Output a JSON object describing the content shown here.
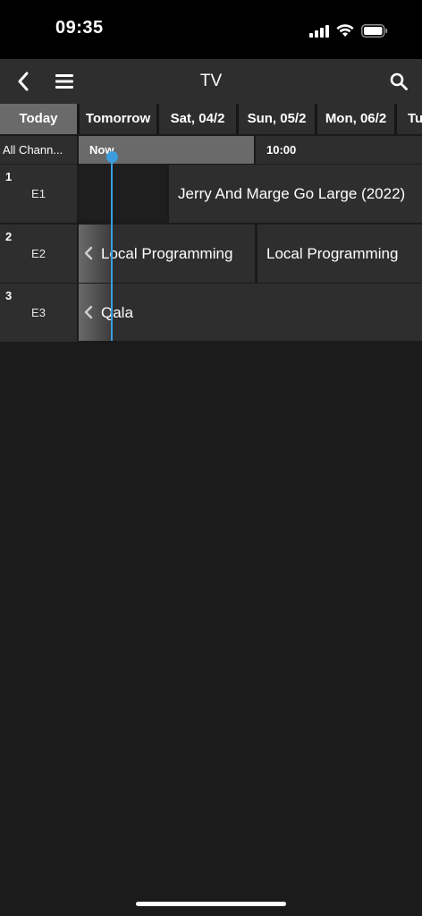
{
  "status_bar": {
    "time": "09:35",
    "icons": [
      "signal-icon",
      "wifi-icon",
      "battery-icon"
    ]
  },
  "nav": {
    "title": "TV",
    "back_icon": "chevron-left-icon",
    "menu_icon": "hamburger-menu-icon",
    "search_icon": "search-icon"
  },
  "day_tabs": [
    {
      "label": "Today",
      "active": true
    },
    {
      "label": "Tomorrow",
      "active": false
    },
    {
      "label": "Sat, 04/2",
      "active": false
    },
    {
      "label": "Sun, 05/2",
      "active": false
    },
    {
      "label": "Mon, 06/2",
      "active": false
    },
    {
      "label": "Tue",
      "active": false
    }
  ],
  "timeline": {
    "channel_filter": "All Chann...",
    "now_label": "Now",
    "slot_label": "10:00"
  },
  "channels": [
    {
      "number": "1",
      "name": "E1",
      "programs": [
        {
          "title": "",
          "continued": false
        },
        {
          "title": "Jerry And Marge Go Large (2022)",
          "continued": false
        }
      ]
    },
    {
      "number": "2",
      "name": "E2",
      "programs": [
        {
          "title": "Local Programming",
          "continued": true
        },
        {
          "title": "Local Programming",
          "continued": false
        }
      ]
    },
    {
      "number": "3",
      "name": "E3",
      "programs": [
        {
          "title": "Qala",
          "continued": true
        }
      ]
    }
  ],
  "colors": {
    "background": "#1b1b1b",
    "cell": "#2e2e2e",
    "active_tab": "#6a6a6a",
    "now_indicator": "#3b9de0"
  }
}
